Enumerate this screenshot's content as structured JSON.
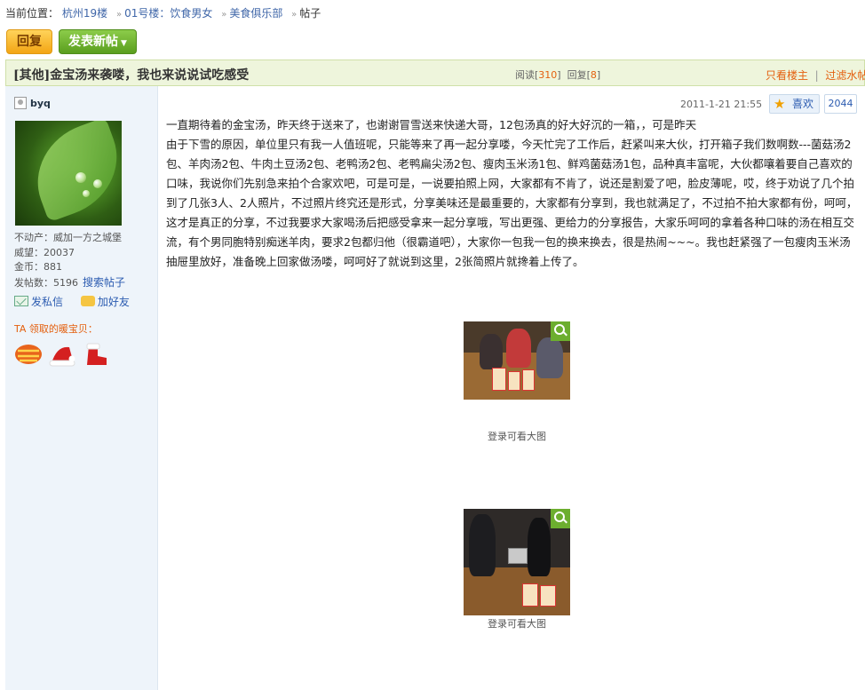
{
  "breadcrumb": {
    "prefix": "当前位置：",
    "items": [
      "杭州19楼",
      "01号楼：饮食男女",
      "美食俱乐部"
    ],
    "current": "帖子"
  },
  "toolbar": {
    "reply_label": "回复",
    "new_post_label": "发表新帖"
  },
  "thread": {
    "title": "[其他]金宝汤来袭喽，我也来说说试吃感受",
    "read_label": "阅读",
    "read_count": "310",
    "reply_label": "回复",
    "reply_count": "8",
    "only_op_label": "只看楼主",
    "separator": "|",
    "filter_label": "过滤水帖"
  },
  "author": {
    "name": "byq",
    "estate_label": "不动产：",
    "estate_value": "威加一方之城堡",
    "prestige_label": "威望：",
    "prestige_value": "20037",
    "coins_label": "金币：",
    "coins_value": "881",
    "posts_label": "发帖数：",
    "posts_value": "5196",
    "search_posts_label": "搜索帖子",
    "pm_label": "发私信",
    "add_friend_label": "加好友",
    "gifts_label": "TA 领取的暖宝贝："
  },
  "post": {
    "date": "2011-1-21 21:55",
    "like_label": "喜欢",
    "like_count": "2044",
    "body": "一直期待着的金宝汤，昨天终于送来了，也谢谢冒雪送来快递大哥，12包汤真的好大好沉的一箱，，可是昨天\n由于下雪的原因，单位里只有我一人值班呢，只能等来了再一起分享喽，今天忙完了工作后，赶紧叫来大伙，打开箱子我们数啊数---菌菇汤2包、羊肉汤2包、牛肉土豆汤2包、老鸭汤2包、老鸭扁尖汤2包、瘦肉玉米汤1包、鲜鸡菌菇汤1包，品种真丰富呢，大伙都嚷着要自己喜欢的口味，我说你们先别急来拍个合家欢吧，可是可是，一说要拍照上网，大家都有不肯了，说还是割爱了吧，脸皮薄呢，哎，终于劝说了几个拍到了几张3人、2人照片，不过照片终究还是形式，分享美味还是最重要的，大家都有分享到，我也就满足了，不过拍不拍大家都有份，呵呵，这才是真正的分享，不过我要求大家喝汤后把感受拿来一起分享哦，写出更强、更给力的分享报告，大家乐呵呵的拿着各种口味的汤在相互交流，有个男同胞特别痴迷羊肉，要求2包都归他（很霸道吧），大家你一包我一包的换来换去，很是热闹~~~。我也赶紧强了一包瘦肉玉米汤抽屉里放好，准备晚上回家做汤喽，呵呵好了就说到这里，2张简照片就搀着上传了。",
    "image_caption_1": "登录可看大图",
    "image_caption_2": "登录可看大图"
  },
  "colors": {
    "link": "#3f66a8",
    "accent_orange": "#e4600f",
    "titlebar_bg": "#eef5dc",
    "sidebar_bg": "#eef4fa",
    "reply_button": "#f3a514",
    "new_post_button": "#5a9e1e"
  },
  "icons": [
    "user-icon",
    "mail-icon",
    "add-friend-icon",
    "star-icon",
    "zoom-icon",
    "scarf-gift-icon",
    "santa-hat-gift-icon",
    "boot-gift-icon"
  ]
}
